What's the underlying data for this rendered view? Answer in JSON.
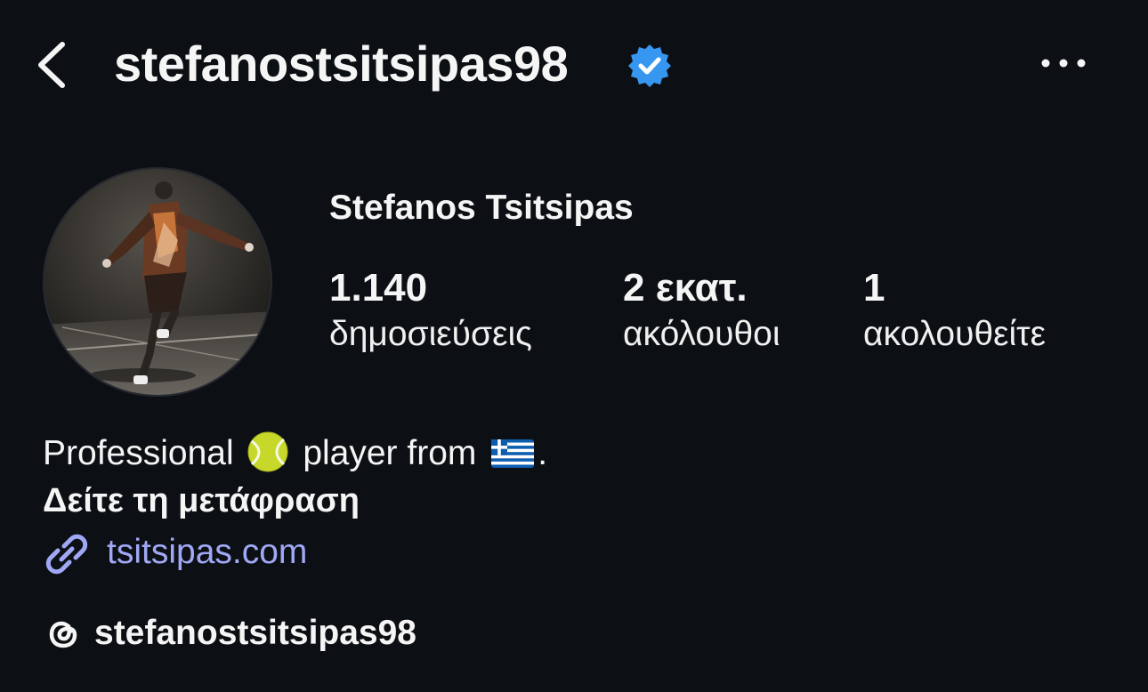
{
  "header": {
    "username": "stefanostsitsipas98",
    "verified": true,
    "back_icon": "chevron-left-icon",
    "more_icon": "more-horizontal-icon",
    "verified_color": "#3797f0"
  },
  "profile": {
    "full_name": "Stefanos Tsitsipas",
    "stats": {
      "posts": {
        "value": "1.140",
        "label": "δημοσιεύσεις"
      },
      "followers": {
        "value": "2 εκατ.",
        "label": "ακόλουθοι"
      },
      "following": {
        "value": "1",
        "label": "ακολουθείτε"
      }
    }
  },
  "bio": {
    "text_part1": "Professional",
    "text_part2": "player from",
    "text_part3": ".",
    "emoji_1": "tennis-ball-emoji",
    "emoji_2": "greek-flag-emoji",
    "translate_label": "Δείτε τη μετάφραση"
  },
  "link": {
    "text": "tsitsipas.com",
    "color": "#a0a8f5",
    "icon": "link-icon"
  },
  "threads": {
    "handle": "stefanostsitsipas98",
    "icon": "threads-icon"
  }
}
